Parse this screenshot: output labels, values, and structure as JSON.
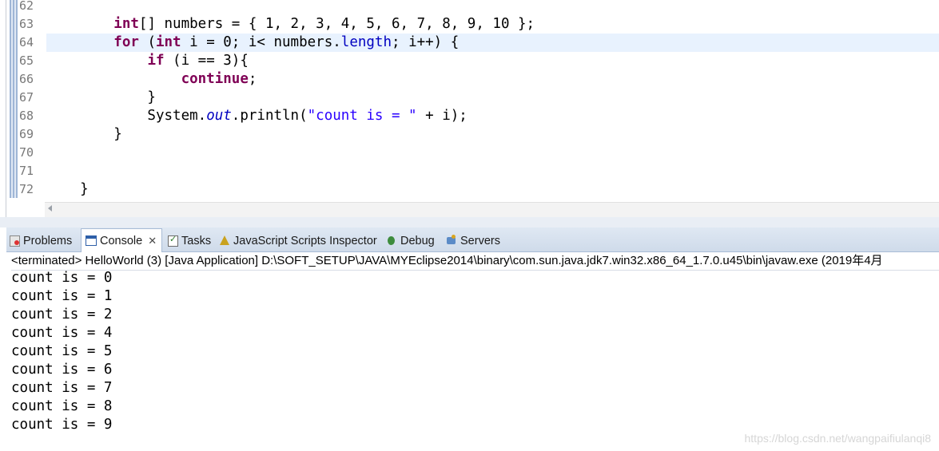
{
  "editor": {
    "current_line": 64,
    "lines": [
      {
        "number": "62",
        "tokens": []
      },
      {
        "number": "63",
        "tokens": [
          {
            "t": "        "
          },
          {
            "t": "int",
            "k": "kw"
          },
          {
            "t": "[] numbers = { 1, 2, 3, 4, 5, 6, 7, 8, 9, 10 };"
          }
        ]
      },
      {
        "number": "64",
        "tokens": [
          {
            "t": "        "
          },
          {
            "t": "for",
            "k": "kw"
          },
          {
            "t": " ("
          },
          {
            "t": "int",
            "k": "kw"
          },
          {
            "t": " i = 0; i< numbers."
          },
          {
            "t": "length",
            "k": "fld"
          },
          {
            "t": "; i++) {"
          }
        ]
      },
      {
        "number": "65",
        "tokens": [
          {
            "t": "            "
          },
          {
            "t": "if",
            "k": "kw"
          },
          {
            "t": " (i == 3){"
          }
        ]
      },
      {
        "number": "66",
        "tokens": [
          {
            "t": "                "
          },
          {
            "t": "continue",
            "k": "kw"
          },
          {
            "t": ";"
          }
        ]
      },
      {
        "number": "67",
        "tokens": [
          {
            "t": "            }"
          }
        ]
      },
      {
        "number": "68",
        "tokens": [
          {
            "t": "            System."
          },
          {
            "t": "out",
            "k": "sfld"
          },
          {
            "t": ".println("
          },
          {
            "t": "\"count is = \"",
            "k": "str"
          },
          {
            "t": " + i);"
          }
        ]
      },
      {
        "number": "69",
        "tokens": [
          {
            "t": "        }"
          }
        ]
      },
      {
        "number": "70",
        "tokens": []
      },
      {
        "number": "71",
        "tokens": []
      },
      {
        "number": "72",
        "tokens": [
          {
            "t": "    }"
          }
        ]
      }
    ]
  },
  "tabs": [
    {
      "id": "tab-problems",
      "label": "Problems",
      "icon": "problems-icon"
    },
    {
      "id": "tab-console",
      "label": "Console",
      "icon": "console-icon",
      "active": true
    },
    {
      "id": "tab-tasks",
      "label": "Tasks",
      "icon": "tasks-icon"
    },
    {
      "id": "tab-jssi",
      "label": "JavaScript Scripts Inspector",
      "icon": "js-inspector-icon"
    },
    {
      "id": "tab-debug",
      "label": "Debug",
      "icon": "debug-icon"
    },
    {
      "id": "tab-servers",
      "label": "Servers",
      "icon": "servers-icon"
    }
  ],
  "console": {
    "status": "<terminated> HelloWorld (3) [Java Application] D:\\SOFT_SETUP\\JAVA\\MYEclipse2014\\binary\\com.sun.java.jdk7.win32.x86_64_1.7.0.u45\\bin\\javaw.exe (2019年4月",
    "output": [
      "count is = 0",
      "count is = 1",
      "count is = 2",
      "count is = 4",
      "count is = 5",
      "count is = 6",
      "count is = 7",
      "count is = 8",
      "count is = 9"
    ]
  },
  "watermark": "https://blog.csdn.net/wangpaifiulanqi8",
  "colors": {
    "keyword": "#7f0055",
    "string": "#2a00ff",
    "field": "#0000c0",
    "current_line_bg": "#e8f2fe",
    "tabbar_bg": "#dfe8f3"
  }
}
